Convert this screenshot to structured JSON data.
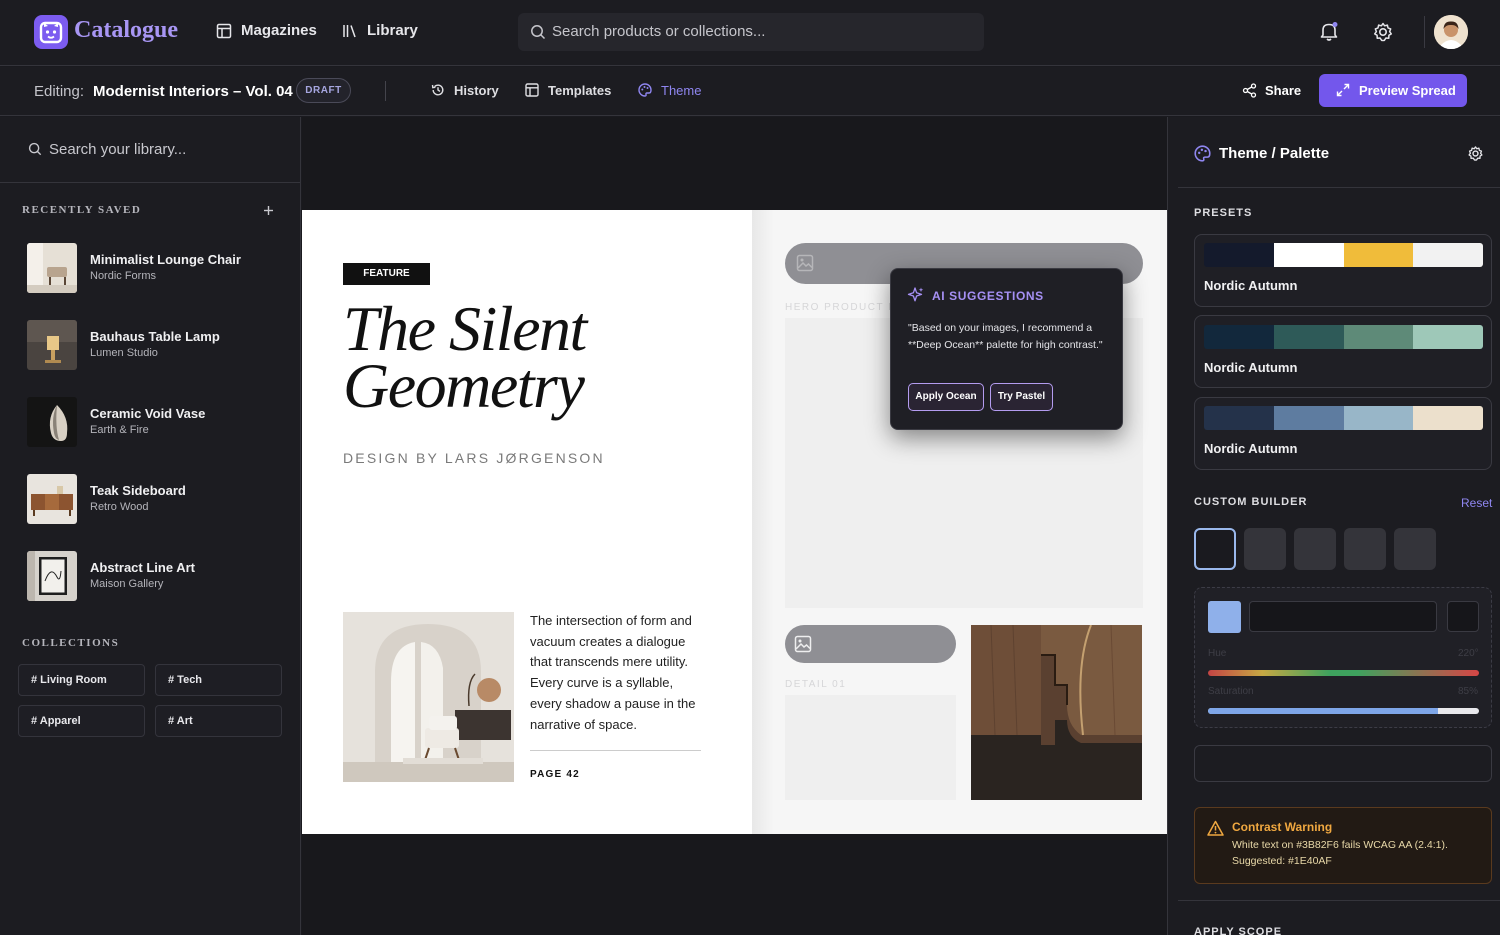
{
  "app": {
    "name": "Catalogue",
    "brand_color": "#7c5cf0",
    "nav": [
      {
        "label": "Magazines",
        "icon": "layout-icon"
      },
      {
        "label": "Library",
        "icon": "library-icon"
      }
    ],
    "search_placeholder": "Search products or collections..."
  },
  "editor": {
    "editing_label": "Editing:",
    "doc_title": "Modernist Interiors – Vol. 04",
    "status_badge": "DRAFT",
    "tabs": [
      {
        "label": "History",
        "icon": "history-icon",
        "active": false
      },
      {
        "label": "Templates",
        "icon": "template-icon",
        "active": false
      },
      {
        "label": "Theme",
        "icon": "palette-icon",
        "active": true
      }
    ],
    "share_label": "Share",
    "preview_label": "Preview Spread",
    "accent_color": "#7357ec"
  },
  "sidebar": {
    "search_placeholder": "Search your library...",
    "recent_label": "RECENTLY SAVED",
    "items": [
      {
        "title": "Minimalist Lounge Chair",
        "subtitle": "Nordic Forms"
      },
      {
        "title": "Bauhaus Table Lamp",
        "subtitle": "Lumen Studio"
      },
      {
        "title": "Ceramic Void Vase",
        "subtitle": "Earth & Fire"
      },
      {
        "title": "Teak Sideboard",
        "subtitle": "Retro Wood"
      },
      {
        "title": "Abstract Line Art",
        "subtitle": "Maison Gallery"
      }
    ],
    "collections_label": "COLLECTIONS",
    "collections": [
      "# Living Room",
      "# Tech",
      "# Apparel",
      "# Art"
    ]
  },
  "spread": {
    "feature_badge": "FEATURE",
    "headline_line1": "The Silent",
    "headline_line2": "Geometry",
    "designer": "DESIGN BY LARS JØRGENSON",
    "body": "The intersection of form and vacuum creates a dialogue that transcends mere utility. Every curve is a syllable, every shadow a pause in the narrative of space.",
    "page_number": "PAGE 42",
    "hero_label": "HERO PRODUCT IM",
    "detail_label": "DETAIL 01"
  },
  "ai_popup": {
    "title": "AI SUGGESTIONS",
    "text": "\"Based on your images, I recommend a **Deep Ocean** palette for high contrast.\"",
    "apply_button": "Apply Ocean",
    "try_button": "Try Pastel"
  },
  "theme_panel": {
    "title": "Theme / Palette",
    "presets_label": "PRESETS",
    "presets": [
      {
        "name": "Nordic Autumn",
        "colors": [
          "#141a2c",
          "#ffffff",
          "#f0bc3a",
          "#f2f2f2"
        ]
      },
      {
        "name": "Nordic Autumn",
        "colors": [
          "#12283c",
          "#2e5a58",
          "#5e8a78",
          "#9ec8b8"
        ]
      },
      {
        "name": "Nordic Autumn",
        "colors": [
          "#24324a",
          "#5e7ca0",
          "#98b6c8",
          "#ece0cc"
        ]
      }
    ],
    "custom_label": "CUSTOM BUILDER",
    "reset_label": "Reset",
    "selected_chip_color": "#8fb0ea",
    "hue_label": "Hue",
    "hue_value": "220°",
    "saturation_label": "Saturation",
    "saturation_value": "85%",
    "saturation_fraction": 0.85,
    "warning_title": "Contrast Warning",
    "warning_text": "White text on #3B82F6 fails WCAG AA (2.4:1). Suggested: #1E40AF",
    "apply_scope_label": "APPLY SCOPE"
  }
}
